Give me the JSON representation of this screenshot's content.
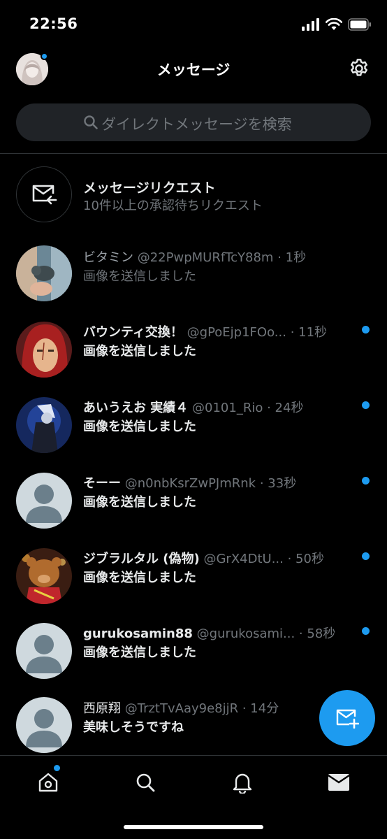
{
  "status_bar": {
    "time": "22:56"
  },
  "header": {
    "title": "メッセージ"
  },
  "search": {
    "placeholder": "ダイレクトメッセージを検索"
  },
  "request": {
    "title": "メッセージリクエスト",
    "subtitle": "10件以上の承認待ちリクエスト"
  },
  "conversations": [
    {
      "name": "ビタミン",
      "handle": "@22PwpMURfTcY88m",
      "time": "· 1秒",
      "preview": "画像を送信しました",
      "unread": false,
      "name_bold": false
    },
    {
      "name": "バウンティ交換！",
      "handle": "@gPoEjp1FOo...",
      "time": "· 11秒",
      "preview": "画像を送信しました",
      "unread": true,
      "name_bold": true
    },
    {
      "name": "あいうえお 実績４",
      "handle": "@0101_Rio",
      "time": "· 24秒",
      "preview": "画像を送信しました",
      "unread": true,
      "name_bold": true
    },
    {
      "name": "そーー",
      "handle": "@n0nbKsrZwPJmRnk",
      "time": "· 33秒",
      "preview": "画像を送信しました",
      "unread": true,
      "name_bold": true
    },
    {
      "name": "ジブラルタル (偽物)",
      "handle": "@GrX4DtU...",
      "time": "· 50秒",
      "preview": "画像を送信しました",
      "unread": true,
      "name_bold": true
    },
    {
      "name": "gurukosamin88",
      "handle": "@gurukosami...",
      "time": "· 58秒",
      "preview": "画像を送信しました",
      "unread": true,
      "name_bold": true
    },
    {
      "name": "西原翔",
      "handle": "@TrztTvAay9e8jjR",
      "time": "· 14分",
      "preview": "美味しそうですね",
      "unread": false,
      "name_bold": false
    }
  ],
  "colors": {
    "accent": "#1d9bf0",
    "background": "#000000",
    "muted": "#71767b",
    "divider": "#2f3336"
  },
  "icons": [
    "signal-icon",
    "wifi-icon",
    "battery-icon",
    "gear-icon",
    "search-icon",
    "message-request-icon",
    "new-message-icon",
    "home-icon",
    "bell-icon",
    "mail-icon"
  ]
}
